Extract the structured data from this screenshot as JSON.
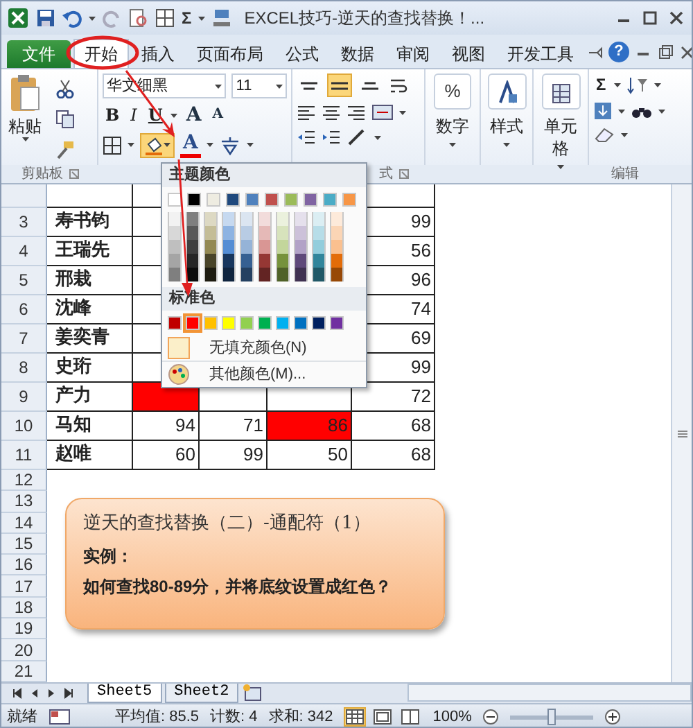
{
  "window": {
    "title": "EXCEL技巧-逆天的查找替换！...",
    "quick_sum": "Σ"
  },
  "ribbon_tabs": [
    {
      "label": "文件",
      "kind": "file",
      "selected": false
    },
    {
      "label": "开始",
      "kind": "tab",
      "selected": true
    },
    {
      "label": "插入",
      "kind": "tab",
      "selected": false
    },
    {
      "label": "页面布局",
      "kind": "tab",
      "selected": false
    },
    {
      "label": "公式",
      "kind": "tab",
      "selected": false
    },
    {
      "label": "数据",
      "kind": "tab",
      "selected": false
    },
    {
      "label": "审阅",
      "kind": "tab",
      "selected": false
    },
    {
      "label": "视图",
      "kind": "tab",
      "selected": false
    },
    {
      "label": "开发工具",
      "kind": "tab",
      "selected": false
    }
  ],
  "help": "?",
  "ribbon": {
    "paste_label": "粘贴",
    "font_name": "华文细黑",
    "font_size": "11",
    "bold": "B",
    "italic": "I",
    "underline": "U",
    "grow": "A",
    "shrink": "A",
    "font_color": "A",
    "fill_open": true,
    "align_buttons": [
      {
        "kind": "top",
        "selected": false
      },
      {
        "kind": "middle",
        "selected": true
      },
      {
        "kind": "bottom",
        "selected": false
      }
    ],
    "number_symbol": "%",
    "number_label": "数字",
    "styles_label": "样式",
    "cells_label": "单元格",
    "sum": "Σ",
    "group_labels": [
      {
        "label": "剪贴板",
        "launcher": true
      },
      {
        "label": "式",
        "launcher": true
      },
      {
        "label": "编辑",
        "launcher": false
      }
    ]
  },
  "rows": [
    {
      "number": "3",
      "cells": [
        {
          "text": "寿书钧",
          "filled": false
        },
        {
          "filled": false
        },
        null,
        null,
        {
          "text": "99",
          "filled": false
        }
      ]
    },
    {
      "number": "4",
      "cells": [
        {
          "text": "王瑞先",
          "filled": false
        },
        {
          "filled": false
        },
        null,
        null,
        {
          "text": "56",
          "filled": false
        }
      ]
    },
    {
      "number": "5",
      "cells": [
        {
          "text": "邢栽",
          "filled": false
        },
        {
          "filled": false
        },
        null,
        null,
        {
          "text": "96",
          "filled": false
        }
      ]
    },
    {
      "number": "6",
      "cells": [
        {
          "text": "沈峰",
          "filled": false
        },
        {
          "filled": false
        },
        null,
        null,
        {
          "text": "74",
          "filled": false
        }
      ]
    },
    {
      "number": "7",
      "cells": [
        {
          "text": "姜奕青",
          "filled": false
        },
        {
          "filled": false
        },
        null,
        null,
        {
          "text": "69",
          "filled": false
        }
      ]
    },
    {
      "number": "8",
      "cells": [
        {
          "text": "史珩",
          "filled": false
        },
        {
          "filled": false
        },
        null,
        null,
        {
          "text": "99",
          "filled": false
        }
      ]
    },
    {
      "number": "9",
      "cells": [
        {
          "text": "产力",
          "filled": false
        },
        {
          "filled": true
        },
        {
          "filled": false
        },
        {
          "filled": false
        },
        {
          "text": "72",
          "filled": false
        }
      ]
    },
    {
      "number": "10",
      "cells": [
        {
          "text": "马知",
          "filled": false
        },
        {
          "text": "94",
          "filled": false
        },
        {
          "text": "71",
          "filled": false
        },
        {
          "text": "86",
          "filled": true
        },
        {
          "text": "68",
          "filled": false
        }
      ]
    },
    {
      "number": "11",
      "cells": [
        {
          "text": "赵唯",
          "filled": false
        },
        {
          "text": "60",
          "filled": false
        },
        {
          "text": "99",
          "filled": false
        },
        {
          "text": "50",
          "filled": false
        },
        {
          "text": "68",
          "filled": false
        }
      ]
    },
    {
      "number": "12"
    },
    {
      "number": "13"
    },
    {
      "number": "14"
    },
    {
      "number": "15"
    },
    {
      "number": "16"
    },
    {
      "number": "17"
    },
    {
      "number": "18"
    },
    {
      "number": "19"
    },
    {
      "number": "20"
    },
    {
      "number": "21"
    }
  ],
  "callout": {
    "title": "逆天的查找替换（二）-通配符（1）",
    "subtitle": "实例：",
    "question": "如何查找80-89分，并将底纹设置成红色？"
  },
  "color_menu": {
    "theme_heading": "主题颜色",
    "theme_colors": [
      {
        "color": "#ffffff"
      },
      {
        "color": "#000000"
      },
      {
        "color": "#eeece1"
      },
      {
        "color": "#1f497d"
      },
      {
        "color": "#4f81bd"
      },
      {
        "color": "#c0504d"
      },
      {
        "color": "#9bbb59"
      },
      {
        "color": "#8064a2"
      },
      {
        "color": "#4bacc6"
      },
      {
        "color": "#f79646"
      }
    ],
    "shades": [
      [
        {
          "color": "#f2f2f2"
        },
        {
          "color": "#7f7f7f"
        },
        {
          "color": "#ddd9c3"
        },
        {
          "color": "#c6d9f0"
        },
        {
          "color": "#dbe5f1"
        },
        {
          "color": "#f2dcdb"
        },
        {
          "color": "#ebf1dd"
        },
        {
          "color": "#e5e0ec"
        },
        {
          "color": "#dbeef3"
        },
        {
          "color": "#fdeada"
        }
      ],
      [
        {
          "color": "#d8d8d8"
        },
        {
          "color": "#595959"
        },
        {
          "color": "#c4bd97"
        },
        {
          "color": "#8db3e2"
        },
        {
          "color": "#b8cce4"
        },
        {
          "color": "#e5b9b7"
        },
        {
          "color": "#d7e3bc"
        },
        {
          "color": "#ccc1d9"
        },
        {
          "color": "#b7dde8"
        },
        {
          "color": "#fbd5b5"
        }
      ],
      [
        {
          "color": "#bfbfbf"
        },
        {
          "color": "#3f3f3f"
        },
        {
          "color": "#938953"
        },
        {
          "color": "#548dd4"
        },
        {
          "color": "#95b3d7"
        },
        {
          "color": "#d99694"
        },
        {
          "color": "#c3d69b"
        },
        {
          "color": "#b2a2c7"
        },
        {
          "color": "#92cddc"
        },
        {
          "color": "#fac08f"
        }
      ],
      [
        {
          "color": "#a5a5a5"
        },
        {
          "color": "#262626"
        },
        {
          "color": "#494429"
        },
        {
          "color": "#17365d"
        },
        {
          "color": "#366092"
        },
        {
          "color": "#953734"
        },
        {
          "color": "#76923c"
        },
        {
          "color": "#5f497a"
        },
        {
          "color": "#31859b"
        },
        {
          "color": "#e36c09"
        }
      ],
      [
        {
          "color": "#7f7f7f"
        },
        {
          "color": "#0c0c0c"
        },
        {
          "color": "#1d1b10"
        },
        {
          "color": "#0f243e"
        },
        {
          "color": "#244061"
        },
        {
          "color": "#632423"
        },
        {
          "color": "#4f6128"
        },
        {
          "color": "#3f3151"
        },
        {
          "color": "#205867"
        },
        {
          "color": "#974806"
        }
      ]
    ],
    "standard_heading": "标准色",
    "standard_colors": [
      {
        "color": "#c00000",
        "selected": false
      },
      {
        "color": "#ff0000",
        "selected": true
      },
      {
        "color": "#ffc000",
        "selected": false
      },
      {
        "color": "#ffff00",
        "selected": false
      },
      {
        "color": "#92d050",
        "selected": false
      },
      {
        "color": "#00b050",
        "selected": false
      },
      {
        "color": "#00b0f0",
        "selected": false
      },
      {
        "color": "#0070c0",
        "selected": false
      },
      {
        "color": "#002060",
        "selected": false
      },
      {
        "color": "#7030a0",
        "selected": false
      }
    ],
    "no_fill": "无填充颜色(N)",
    "more_colors": "其他颜色(M)..."
  },
  "sheet_tabs": [
    {
      "label": "Sheet5",
      "selected": true
    },
    {
      "label": "Sheet2",
      "selected": false
    }
  ],
  "status_bar": {
    "ready": "就绪",
    "average": "平均值: 85.5",
    "count": "计数: 4",
    "sum": "求和: 342",
    "views": [
      {
        "kind": "normal",
        "selected": true
      },
      {
        "kind": "layout",
        "selected": false
      },
      {
        "kind": "break",
        "selected": false
      }
    ],
    "zoom": "100%",
    "zoom_level": {
      "level": 0.5
    }
  }
}
